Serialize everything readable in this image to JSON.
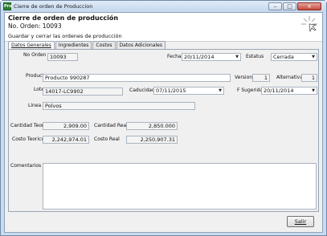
{
  "window": {
    "title": "Cierre de orden de Produccion",
    "minimize": "–",
    "maximize": "□",
    "close": "×"
  },
  "header": {
    "title": "Cierre de orden de producción",
    "order_line": "No. Orden: 10093",
    "description": "Guardar y cerrar las ordenes de producción"
  },
  "tabs": [
    {
      "label": "Datos Generales",
      "active": true
    },
    {
      "label": "Ingredientes",
      "active": false
    },
    {
      "label": "Costos",
      "active": false
    },
    {
      "label": "Datos Adicionales",
      "active": false
    }
  ],
  "form": {
    "no_orden": {
      "label": "No Orden",
      "value": "10093"
    },
    "fecha": {
      "label": "Fecha",
      "value": "20/11/2014"
    },
    "estatus": {
      "label": "Estatus",
      "value": "Cerrada"
    },
    "producto": {
      "label": "Producto",
      "value": "Producto 990287"
    },
    "version": {
      "label": "Version",
      "value": "1"
    },
    "alternativa": {
      "label": "Alternativa",
      "value": "1"
    },
    "lote": {
      "label": "Lote",
      "value": "14017-LC9902"
    },
    "caducidad": {
      "label": "Caducidad",
      "value": "07/11/2015"
    },
    "f_sugerida": {
      "label": "F Sugerida",
      "value": "20/11/2014"
    },
    "linea": {
      "label": "Linea",
      "value": "Polvos"
    },
    "cantidad_teorica": {
      "label": "Cantidad Teorica",
      "value": "2,909.00"
    },
    "cantidad_real": {
      "label": "Cantidad Real",
      "value": "2,850.000"
    },
    "costo_teorico": {
      "label": "Costo Teorico",
      "value": "2,242,974.01"
    },
    "costo_real": {
      "label": "Costo Real",
      "value": "2,250,907.31"
    },
    "comentarios": {
      "label": "Comentarios",
      "value": ""
    }
  },
  "buttons": {
    "salir": "Salir"
  },
  "icons": {
    "app": "app-icon",
    "wizard": "wizard-sparkle-icon",
    "dropdown": "chevron-down-icon"
  }
}
